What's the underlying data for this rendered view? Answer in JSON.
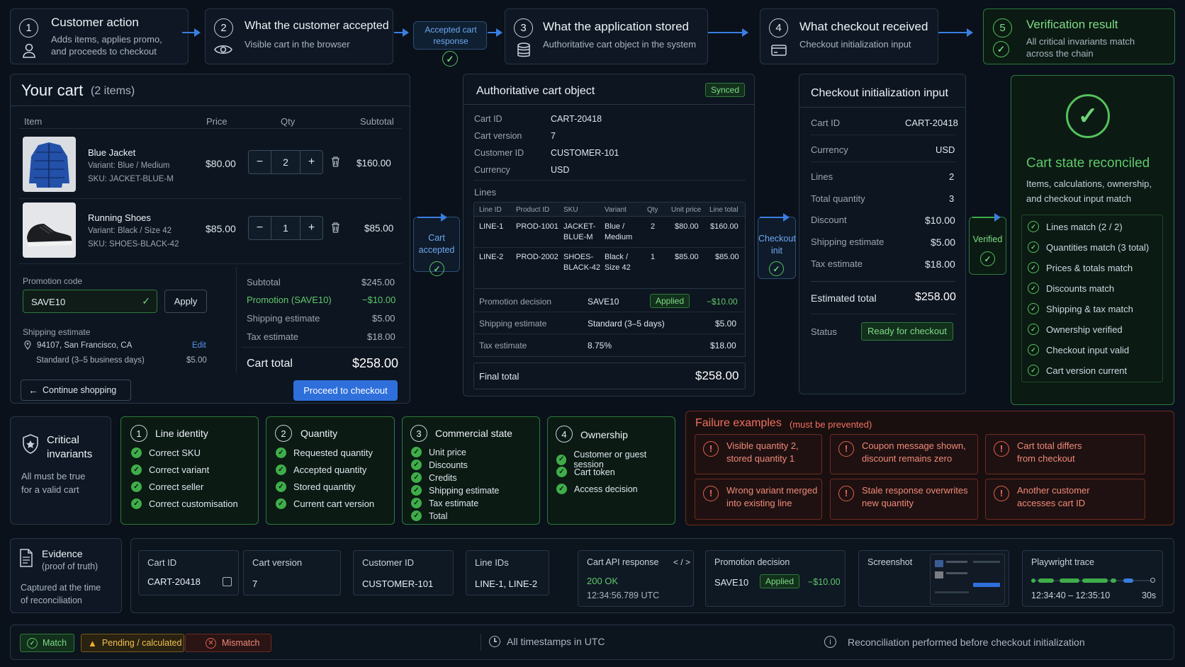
{
  "steps": [
    {
      "n": "1",
      "title": "Customer action",
      "sub1": "Adds items, applies promo,",
      "sub2": "and proceeds to checkout"
    },
    {
      "n": "2",
      "title": "What the customer accepted",
      "sub1": "Visible cart in the browser"
    },
    {
      "n": "3",
      "title": "What the application stored",
      "sub1": "Authoritative cart object in the system"
    },
    {
      "n": "4",
      "title": "What checkout received",
      "sub1": "Checkout initialization input"
    },
    {
      "n": "5",
      "title": "Verification result",
      "sub1": "All critical invariants match",
      "sub2": "across the chain"
    }
  ],
  "connectors": {
    "accepted_response": "Accepted cart response",
    "cart_accepted": "Cart accepted",
    "checkout_init": "Checkout init",
    "verified": "Verified"
  },
  "cart": {
    "title": "Your cart",
    "count": "(2 items)",
    "headers": {
      "item": "Item",
      "price": "Price",
      "qty": "Qty",
      "subtotal": "Subtotal"
    },
    "items": [
      {
        "name": "Blue Jacket",
        "variant": "Variant: Blue / Medium",
        "sku": "SKU: JACKET-BLUE-M",
        "price": "$80.00",
        "qty": "2",
        "subtotal": "$160.00"
      },
      {
        "name": "Running Shoes",
        "variant": "Variant: Black / Size 42",
        "sku": "SKU: SHOES-BLACK-42",
        "price": "$85.00",
        "qty": "1",
        "subtotal": "$85.00"
      }
    ],
    "promo_label": "Promotion code",
    "promo_value": "SAVE10",
    "apply": "Apply",
    "ship_label": "Shipping estimate",
    "ship_addr": "94107, San Francisco, CA",
    "edit": "Edit",
    "ship_method": "Standard (3–5 business days)",
    "ship_price": "$5.00",
    "totals": [
      {
        "k": "Subtotal",
        "v": "$245.00"
      },
      {
        "k": "Promotion (SAVE10)",
        "v": "−$10.00"
      },
      {
        "k": "Shipping estimate",
        "v": "$5.00"
      },
      {
        "k": "Tax estimate",
        "v": "$18.00"
      }
    ],
    "total_label": "Cart total",
    "total_value": "$258.00",
    "continue": "Continue shopping",
    "proceed": "Proceed to checkout"
  },
  "stored": {
    "title": "Authoritative cart object",
    "synced": "Synced",
    "fields": [
      {
        "k": "Cart ID",
        "v": "CART-20418"
      },
      {
        "k": "Cart version",
        "v": "7"
      },
      {
        "k": "Customer ID",
        "v": "CUSTOMER-101"
      },
      {
        "k": "Currency",
        "v": "USD"
      }
    ],
    "lines_label": "Lines",
    "cols": [
      "Line ID",
      "Product ID",
      "SKU",
      "Variant",
      "Qty",
      "Unit price",
      "Line total"
    ],
    "lines": [
      {
        "id": "LINE-1",
        "pid": "PROD-1001",
        "sku1": "JACKET-",
        "sku2": "BLUE-M",
        "var1": "Blue /",
        "var2": "Medium",
        "qty": "2",
        "unit": "$80.00",
        "total": "$160.00"
      },
      {
        "id": "LINE-2",
        "pid": "PROD-2002",
        "sku1": "SHOES-",
        "sku2": "BLACK-42",
        "var1": "Black /",
        "var2": "Size 42",
        "qty": "1",
        "unit": "$85.00",
        "total": "$85.00"
      }
    ],
    "promo": {
      "k": "Promotion decision",
      "code": "SAVE10",
      "status": "Applied",
      "v": "−$10.00"
    },
    "ship": {
      "k": "Shipping estimate",
      "m": "Standard (3–5 days)",
      "v": "$5.00"
    },
    "tax": {
      "k": "Tax estimate",
      "m": "8.75%",
      "v": "$18.00"
    },
    "final_label": "Final total",
    "final_value": "$258.00"
  },
  "checkout": {
    "title": "Checkout initialization input",
    "rows": [
      {
        "k": "Cart ID",
        "v": "CART-20418"
      },
      {
        "k": "Currency",
        "v": "USD"
      },
      {
        "k": "Lines",
        "v": "2"
      },
      {
        "k": "Total quantity",
        "v": "3"
      },
      {
        "k": "Discount",
        "v": "$10.00"
      },
      {
        "k": "Shipping estimate",
        "v": "$5.00"
      },
      {
        "k": "Tax estimate",
        "v": "$18.00"
      }
    ],
    "est_label": "Estimated total",
    "est_value": "$258.00",
    "status_label": "Status",
    "status_value": "Ready for checkout"
  },
  "verify": {
    "title": "Cart state reconciled",
    "sub1": "Items, calculations, ownership,",
    "sub2": "and checkout input match",
    "checks": [
      "Lines match (2 / 2)",
      "Quantities match (3 total)",
      "Prices & totals match",
      "Discounts match",
      "Shipping & tax match",
      "Ownership verified",
      "Checkout input valid",
      "Cart version current"
    ]
  },
  "invariants": {
    "title1": "Critical",
    "title2": "invariants",
    "sub1": "All must be true",
    "sub2": "for a valid cart",
    "groups": [
      {
        "n": "1",
        "title": "Line identity",
        "items": [
          "Correct SKU",
          "Correct variant",
          "Correct seller",
          "Correct customisation"
        ]
      },
      {
        "n": "2",
        "title": "Quantity",
        "items": [
          "Requested quantity",
          "Accepted quantity",
          "Stored quantity",
          "Current cart version"
        ]
      },
      {
        "n": "3",
        "title": "Commercial state",
        "items": [
          "Unit price",
          "Discounts",
          "Credits",
          "Shipping estimate",
          "Tax estimate",
          "Total"
        ]
      },
      {
        "n": "4",
        "title": "Ownership",
        "items": [
          "Customer or guest session",
          "Cart token",
          "Access decision"
        ]
      }
    ]
  },
  "failures": {
    "title": "Failure examples",
    "note": "(must be prevented)",
    "items": [
      {
        "l1": "Visible quantity 2,",
        "l2": "stored quantity 1"
      },
      {
        "l1": "Coupon message shown,",
        "l2": "discount remains zero"
      },
      {
        "l1": "Cart total differs",
        "l2": "from checkout"
      },
      {
        "l1": "Wrong variant merged",
        "l2": "into existing line"
      },
      {
        "l1": "Stale response overwrites",
        "l2": "new quantity"
      },
      {
        "l1": "Another customer",
        "l2": "accesses cart ID"
      }
    ]
  },
  "evidence": {
    "title": "Evidence",
    "sub": "(proof of truth)",
    "cap1": "Captured at the time",
    "cap2": "of reconciliation",
    "cart_id": {
      "h": "Cart ID",
      "v": "CART-20418"
    },
    "version": {
      "h": "Cart version",
      "v": "7"
    },
    "customer": {
      "h": "Customer ID",
      "v": "CUSTOMER-101"
    },
    "lines": {
      "h": "Line IDs",
      "v": "LINE-1, LINE-2"
    },
    "api": {
      "h": "Cart API response",
      "code": "< / >",
      "status": "200 OK",
      "time": "12:34:56.789 UTC"
    },
    "promo": {
      "h": "Promotion decision",
      "code": "SAVE10",
      "status": "Applied",
      "v": "−$10.00"
    },
    "screenshot": {
      "h": "Screenshot"
    },
    "trace": {
      "h": "Playwright trace",
      "range": "12:34:40 – 12:35:10",
      "dur": "30s"
    }
  },
  "legend": {
    "match": "Match",
    "pending": "Pending / calculated",
    "mismatch": "Mismatch",
    "utc": "All timestamps in UTC",
    "note": "Reconciliation performed before checkout initialization"
  },
  "colors": {
    "accent": "#2f6fdc",
    "green": "#4cb859",
    "red": "#e0604c",
    "bg": "#0a111b"
  }
}
